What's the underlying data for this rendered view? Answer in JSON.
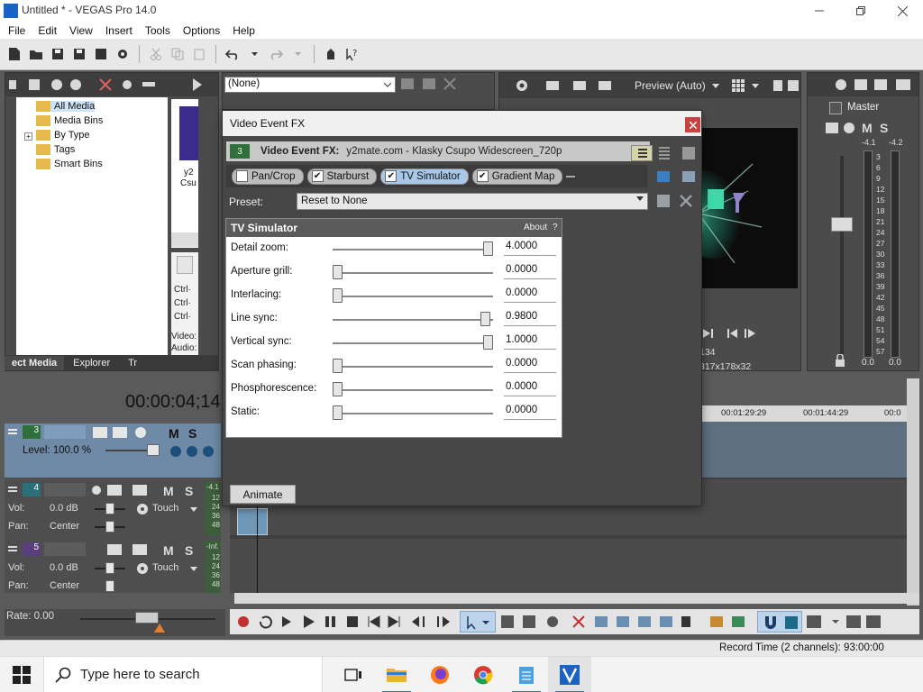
{
  "window": {
    "title": "Untitled * - VEGAS Pro 14.0"
  },
  "menu": [
    "File",
    "Edit",
    "View",
    "Insert",
    "Tools",
    "Options",
    "Help"
  ],
  "media_pane": {
    "tree": [
      "All Media",
      "Media Bins",
      "By Type",
      "Tags",
      "Smart Bins"
    ],
    "tabs": [
      "ect Media",
      "Explorer",
      "Tr"
    ],
    "thumb_caption": [
      "y2",
      "Csu"
    ],
    "info_lines": [
      "Ctrl·",
      "Ctrl·",
      "Ctrl·",
      "Video:",
      "Audio:"
    ],
    "top_dropdown": "(None)"
  },
  "preview": {
    "label": "Preview (Auto)",
    "frame_info_1": "134",
    "frame_info_2": "317x178x32"
  },
  "master": {
    "label": "Master",
    "left_peak": "-4.1",
    "right_peak": "-4.2",
    "scale": [
      "3",
      "6",
      "9",
      "12",
      "15",
      "18",
      "21",
      "24",
      "27",
      "30",
      "33",
      "36",
      "39",
      "42",
      "45",
      "48",
      "51",
      "54",
      "57"
    ],
    "left_level": "0.0",
    "right_level": "0.0"
  },
  "timeline": {
    "timecode": "00:00:04;14",
    "ruler_marks": [
      "00:01:29:29",
      "00:01:44:29",
      "00:0"
    ],
    "track3": {
      "number": "3",
      "level": "Level: 100.0 %"
    },
    "track4": {
      "number": "4",
      "vol_label": "Vol:",
      "vol": "0.0 dB",
      "pan_label": "Pan:",
      "pan": "Center",
      "touch": "Touch",
      "meter": [
        "-4.1",
        "12",
        "24",
        "36",
        "48"
      ]
    },
    "track5": {
      "number": "5",
      "vol_label": "Vol:",
      "vol": "0.0 dB",
      "pan_label": "Pan:",
      "pan": "Center",
      "touch": "Touch",
      "meter": [
        "-Inf.",
        "12",
        "24",
        "36",
        "48"
      ]
    },
    "rate": "Rate: 0.00"
  },
  "status": {
    "record_time": "Record Time (2 channels): 93:00:00"
  },
  "taskbar": {
    "search_placeholder": "Type here to search"
  },
  "dialog": {
    "title": "Video Event FX",
    "fx_badge": "3",
    "fx_label": "Video Event FX:",
    "fx_source": "y2mate.com - Klasky Csupo Widescreen_720p",
    "chain": [
      {
        "label": "Pan/Crop",
        "checked": false,
        "selected": false
      },
      {
        "label": "Starburst",
        "checked": true,
        "selected": false
      },
      {
        "label": "TV Simulator",
        "checked": true,
        "selected": true
      },
      {
        "label": "Gradient Map",
        "checked": true,
        "selected": false
      }
    ],
    "preset_label": "Preset:",
    "preset_value": "Reset to None",
    "plugin_title": "TV Simulator",
    "about": "About",
    "about_q": "?",
    "params": [
      {
        "label": "Detail zoom:",
        "value": "4.0000",
        "level": 1.0
      },
      {
        "label": "Aperture grill:",
        "value": "0.0000",
        "level": 0.0
      },
      {
        "label": "Interlacing:",
        "value": "0.0000",
        "level": 0.0
      },
      {
        "label": "Line sync:",
        "value": "0.9800",
        "level": 0.98
      },
      {
        "label": "Vertical sync:",
        "value": "1.0000",
        "level": 1.0
      },
      {
        "label": "Scan phasing:",
        "value": "0.0000",
        "level": 0.0
      },
      {
        "label": "Phosphorescence:",
        "value": "0.0000",
        "level": 0.0
      },
      {
        "label": "Static:",
        "value": "0.0000",
        "level": 0.0
      }
    ],
    "animate_label": "Animate"
  }
}
